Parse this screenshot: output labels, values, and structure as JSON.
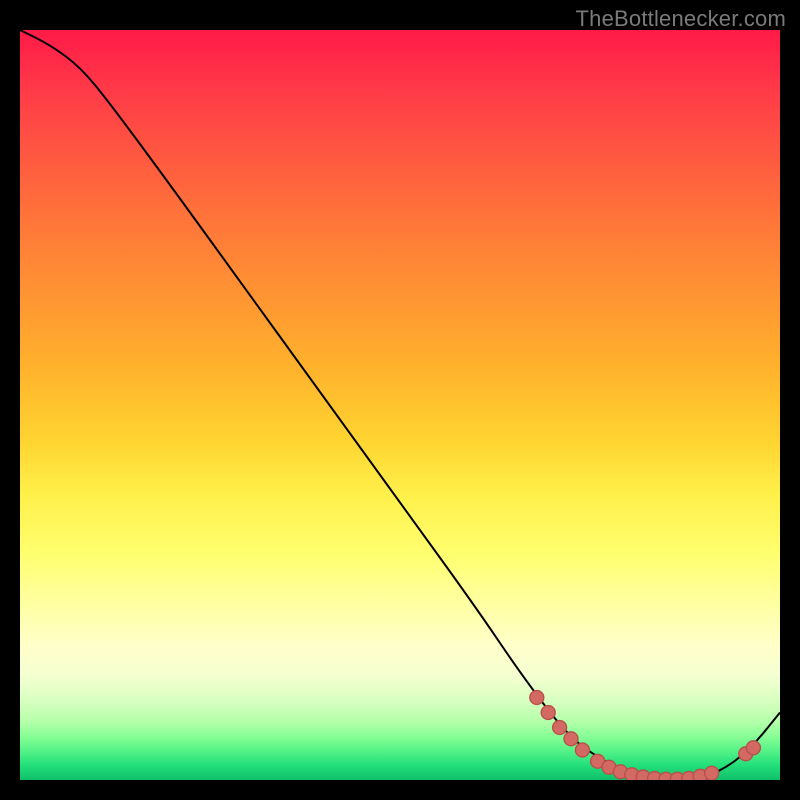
{
  "attribution": "TheBottlenecker.com",
  "colors": {
    "background": "#000000",
    "curve": "#000000",
    "marker_fill": "#d26a63",
    "marker_stroke": "#b94f49",
    "attribution_text": "#7a7a7a"
  },
  "chart_data": {
    "type": "line",
    "title": "",
    "xlabel": "",
    "ylabel": "",
    "xlim": [
      0,
      100
    ],
    "ylim": [
      0,
      100
    ],
    "grid": false,
    "legend": false,
    "annotations": [],
    "series": [
      {
        "name": "bottleneck-curve",
        "x": [
          0,
          4,
          8,
          12,
          20,
          30,
          40,
          50,
          60,
          66,
          72,
          76,
          80,
          84,
          88,
          92,
          96,
          100
        ],
        "y": [
          100,
          98,
          95,
          90,
          79,
          65,
          51,
          37,
          23,
          14,
          6,
          3,
          1,
          0,
          0,
          1,
          4,
          9
        ]
      }
    ],
    "markers": [
      {
        "x": 68,
        "y": 11
      },
      {
        "x": 69.5,
        "y": 9
      },
      {
        "x": 71,
        "y": 7
      },
      {
        "x": 72.5,
        "y": 5.5
      },
      {
        "x": 74,
        "y": 4
      },
      {
        "x": 76,
        "y": 2.5
      },
      {
        "x": 77.5,
        "y": 1.7
      },
      {
        "x": 79,
        "y": 1.1
      },
      {
        "x": 80.5,
        "y": 0.7
      },
      {
        "x": 82,
        "y": 0.4
      },
      {
        "x": 83.5,
        "y": 0.2
      },
      {
        "x": 85,
        "y": 0.1
      },
      {
        "x": 86.5,
        "y": 0.1
      },
      {
        "x": 88,
        "y": 0.2
      },
      {
        "x": 89.5,
        "y": 0.5
      },
      {
        "x": 91,
        "y": 0.9
      },
      {
        "x": 95.5,
        "y": 3.5
      },
      {
        "x": 96.5,
        "y": 4.3
      }
    ],
    "background_gradient": {
      "type": "vertical",
      "stops": [
        {
          "pos": 0,
          "color": "#ff1a47"
        },
        {
          "pos": 45,
          "color": "#ffb22c"
        },
        {
          "pos": 70,
          "color": "#ffff70"
        },
        {
          "pos": 100,
          "color": "#0fbf6a"
        }
      ]
    }
  }
}
